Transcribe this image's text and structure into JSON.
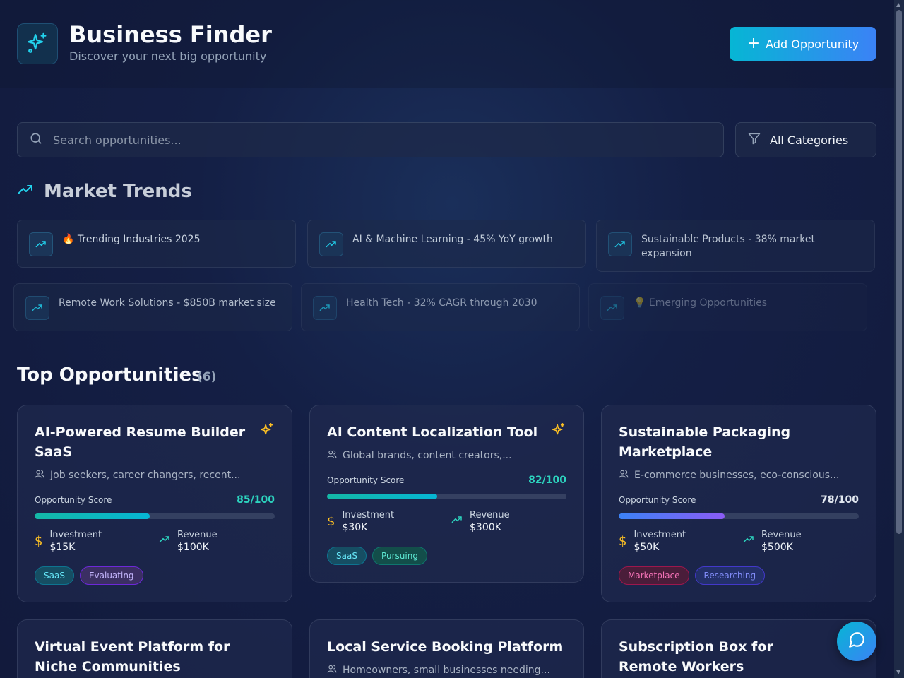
{
  "header": {
    "title": "Business Finder",
    "subtitle": "Discover your next big opportunity",
    "add_button": "Add Opportunity"
  },
  "search": {
    "placeholder": "Search opportunities...",
    "category": "All Categories"
  },
  "trends": {
    "title": "Market Trends",
    "items": [
      "🔥 Trending Industries 2025",
      "AI & Machine Learning - 45% YoY growth",
      "Sustainable Products - 38% market expansion",
      "Remote Work Solutions - $850B market size",
      "Health Tech - 32% CAGR through 2030",
      "💡 Emerging Opportunities"
    ]
  },
  "opportunities": {
    "title": "Top Opportunities",
    "count": "(6)",
    "score_label": "Opportunity Score",
    "investment_label": "Investment",
    "revenue_label": "Revenue",
    "cards": [
      {
        "title": "AI-Powered Resume Builder SaaS",
        "audience": "Job seekers, career changers, recent...",
        "score": "85/100",
        "score_value": 85,
        "score_color": "#2dd4bf",
        "investment": "$15K",
        "revenue": "$100K",
        "tags": [
          "SaaS",
          "Evaluating"
        ],
        "featured": true
      },
      {
        "title": "AI Content Localization Tool",
        "audience": "Global brands, content creators,...",
        "score": "82/100",
        "score_value": 82,
        "score_color": "#2dd4bf",
        "investment": "$30K",
        "revenue": "$300K",
        "tags": [
          "SaaS",
          "Pursuing"
        ],
        "featured": true
      },
      {
        "title": "Sustainable Packaging Marketplace",
        "audience": "E-commerce businesses, eco-conscious...",
        "score": "78/100",
        "score_value": 78,
        "score_color": "#e2e8f0",
        "investment": "$50K",
        "revenue": "$500K",
        "tags": [
          "Marketplace",
          "Researching"
        ],
        "featured": false
      },
      {
        "title": "Virtual Event Platform for Niche Communities"
      },
      {
        "title": "Local Service Booking Platform",
        "audience": "Homeowners, small businesses needing..."
      },
      {
        "title": "Subscription Box for Remote Workers"
      }
    ]
  },
  "colors": {
    "accent": "#06b6d4",
    "accent2": "#3b82f6",
    "gold": "#fbbf24",
    "teal": "#2dd4bf"
  }
}
